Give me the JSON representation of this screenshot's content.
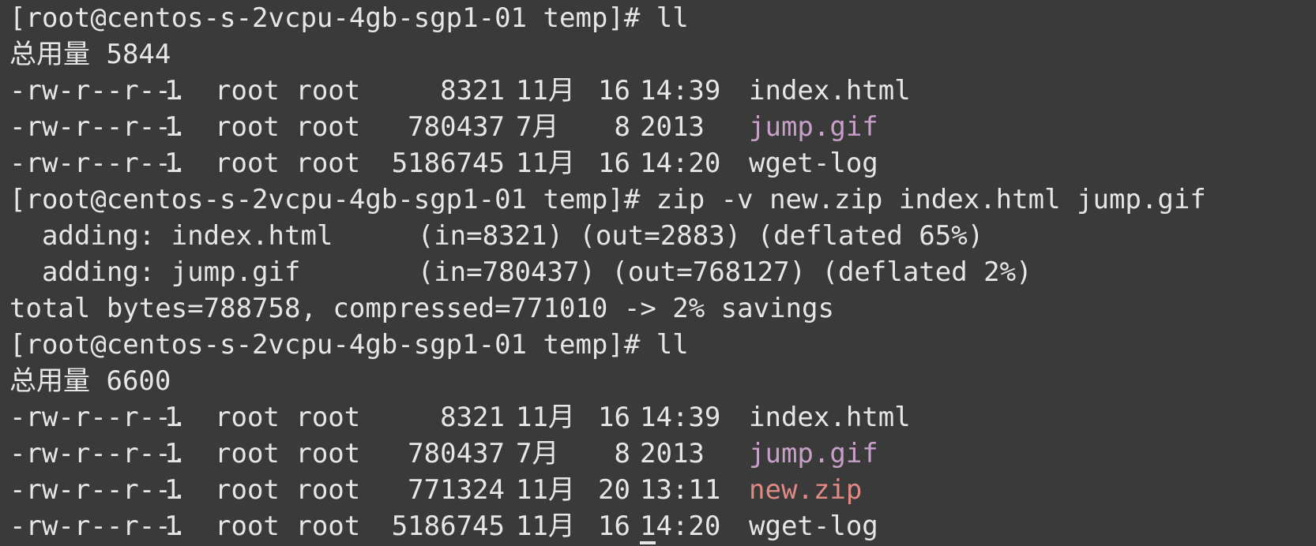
{
  "colors": {
    "background": "#3a3a3a",
    "text": "#e6e6e6",
    "image_file": "#c7a0c7",
    "archive_file": "#e08a84"
  },
  "terminal": {
    "lines": [
      {
        "type": "prompt",
        "prompt": "[root@centos-s-2vcpu-4gb-sgp1-01 temp]# ",
        "command": "ll"
      },
      {
        "type": "total",
        "text": "总用量 5844"
      },
      {
        "type": "file",
        "perms": "-rw-r--r--.",
        "links": "1",
        "owner": "root root",
        "size": "8321",
        "month": "11月",
        "day": "16",
        "time": "14:39",
        "name": "index.html",
        "kind": "plain"
      },
      {
        "type": "file",
        "perms": "-rw-r--r--.",
        "links": "1",
        "owner": "root root",
        "size": "780437",
        "month": "7月",
        "day": "8",
        "time": "2013",
        "name": "jump.gif",
        "kind": "image"
      },
      {
        "type": "file",
        "perms": "-rw-r--r--.",
        "links": "1",
        "owner": "root root",
        "size": "5186745",
        "month": "11月",
        "day": "16",
        "time": "14:20",
        "name": "wget-log",
        "kind": "plain"
      },
      {
        "type": "prompt",
        "prompt": "[root@centos-s-2vcpu-4gb-sgp1-01 temp]# ",
        "command": "zip -v new.zip index.html jump.gif"
      },
      {
        "type": "adding",
        "label": "adding:",
        "name": "index.html",
        "stats": "(in=8321) (out=2883) (deflated 65%)"
      },
      {
        "type": "adding",
        "label": "adding:",
        "name": "jump.gif",
        "stats": "(in=780437) (out=768127) (deflated 2%)"
      },
      {
        "type": "text",
        "text": "total bytes=788758, compressed=771010 -> 2% savings"
      },
      {
        "type": "prompt",
        "prompt": "[root@centos-s-2vcpu-4gb-sgp1-01 temp]# ",
        "command": "ll"
      },
      {
        "type": "total",
        "text": "总用量 6600"
      },
      {
        "type": "file",
        "perms": "-rw-r--r--.",
        "links": "1",
        "owner": "root root",
        "size": "8321",
        "month": "11月",
        "day": "16",
        "time": "14:39",
        "name": "index.html",
        "kind": "plain"
      },
      {
        "type": "file",
        "perms": "-rw-r--r--.",
        "links": "1",
        "owner": "root root",
        "size": "780437",
        "month": "7月",
        "day": "8",
        "time": "2013",
        "name": "jump.gif",
        "kind": "image"
      },
      {
        "type": "file",
        "perms": "-rw-r--r--.",
        "links": "1",
        "owner": "root root",
        "size": "771324",
        "month": "11月",
        "day": "20",
        "time": "13:11",
        "name": "new.zip",
        "kind": "archive"
      },
      {
        "type": "file",
        "perms": "-rw-r--r--.",
        "links": "1",
        "owner": "root root",
        "size": "5186745",
        "month": "11月",
        "day": "16",
        "time": "14:20",
        "name": "wget-log",
        "kind": "plain",
        "cursor": true
      }
    ]
  }
}
